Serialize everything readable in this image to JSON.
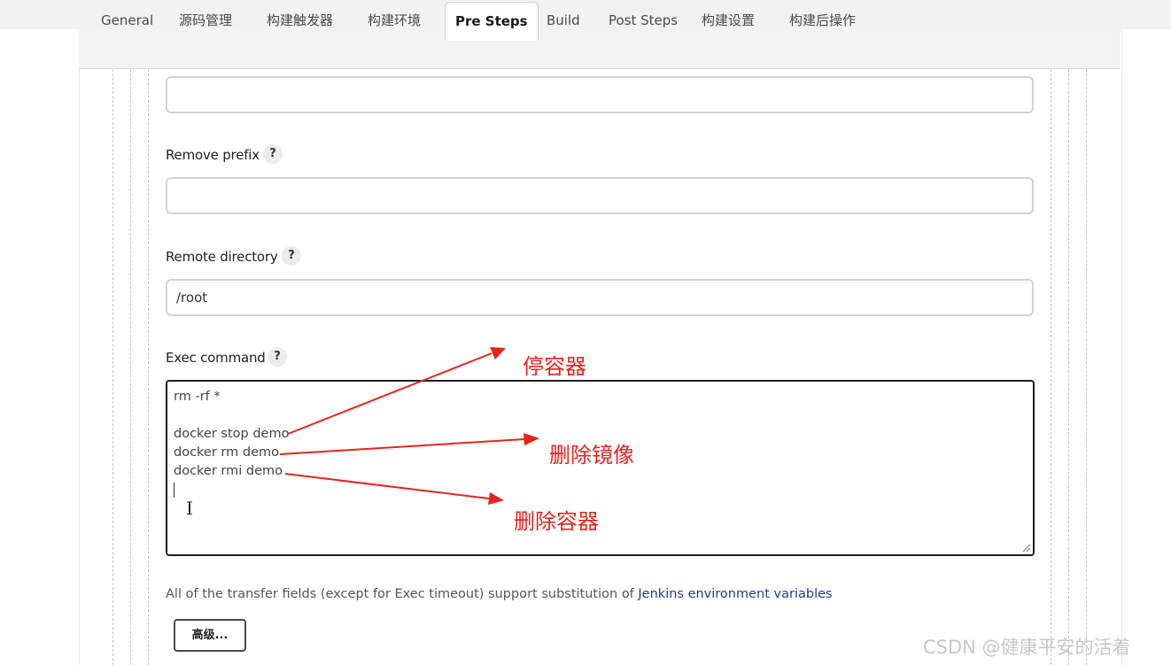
{
  "tabs": [
    {
      "label": "General"
    },
    {
      "label": "源码管理"
    },
    {
      "label": "构建触发器"
    },
    {
      "label": "构建环境"
    },
    {
      "label": "Pre Steps",
      "active": true
    },
    {
      "label": "Build"
    },
    {
      "label": "Post Steps"
    },
    {
      "label": "构建设置"
    },
    {
      "label": "构建后操作"
    }
  ],
  "fields": {
    "top_value": "",
    "remove_prefix": {
      "label": "Remove prefix",
      "help": "?",
      "value": ""
    },
    "remote_directory": {
      "label": "Remote directory",
      "help": "?",
      "value": "/root"
    },
    "exec_command": {
      "label": "Exec command",
      "help": "?",
      "lines": [
        "rm -rf *",
        "",
        "docker stop demo",
        "docker rm demo",
        "docker rmi demo"
      ]
    }
  },
  "note": {
    "text": "All of the transfer fields (except for Exec timeout) support substitution of ",
    "link": "Jenkins environment variables"
  },
  "advanced_button": "高级...",
  "annotations": [
    "停容器",
    "删除镜像",
    "删除容器"
  ],
  "annotation_color": "#e8231c",
  "watermark": "CSDN @健康平安的活着"
}
